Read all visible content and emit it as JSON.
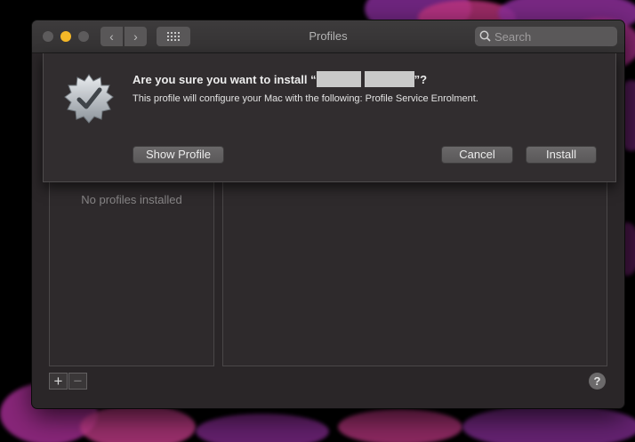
{
  "window": {
    "title": "Profiles",
    "search_placeholder": "Search",
    "back_glyph": "‹",
    "forward_glyph": "›"
  },
  "sheet": {
    "title_prefix": "Are you sure you want to install “",
    "title_suffix": "”?",
    "message": "This profile will configure your Mac with the following: Profile Service Enrolment.",
    "buttons": {
      "show_profile": "Show Profile",
      "cancel": "Cancel",
      "install": "Install"
    }
  },
  "profiles": {
    "empty_text": "No profiles installed",
    "add_glyph": "+",
    "remove_glyph": "−",
    "help_glyph": "?"
  },
  "colors": {
    "accent_minimize": "#f5b828",
    "window_bg": "#2a2628"
  }
}
